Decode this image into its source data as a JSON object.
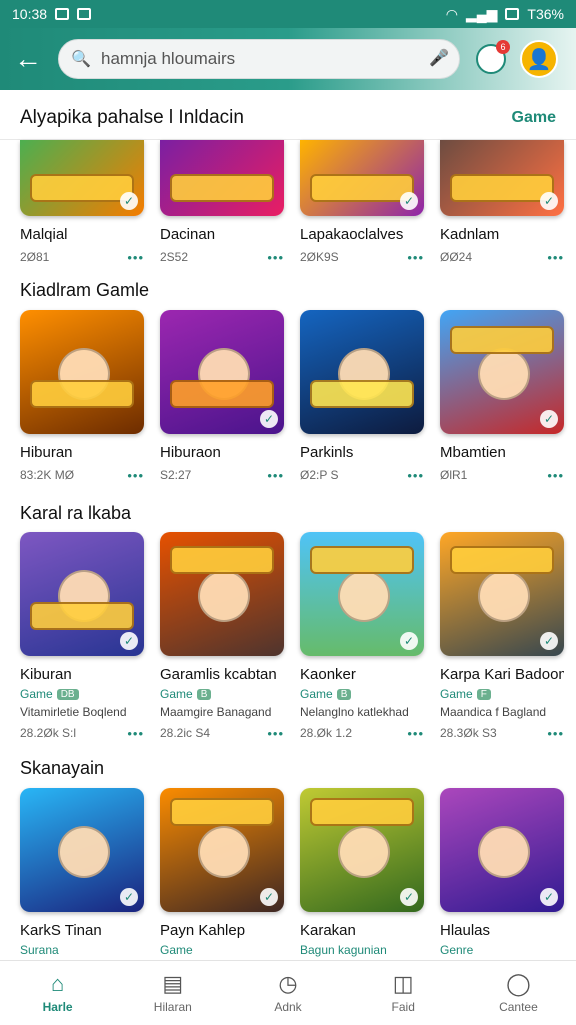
{
  "status": {
    "time": "10:38",
    "battery": "T36%"
  },
  "search": {
    "value": "hamnja hloumairs"
  },
  "notifications": {
    "badge": "6"
  },
  "header": {
    "title": "Alyapika pahalse l Inldacin",
    "tab_label": "Game"
  },
  "sections": [
    {
      "items": [
        {
          "name": "Malqial",
          "count": "2Ø81"
        },
        {
          "name": "Dacinan",
          "count": "2S52"
        },
        {
          "name": "Lapakaoclalves",
          "count": "2ØK9S"
        },
        {
          "name": "Kadnlam",
          "count": "ØØ24"
        }
      ]
    },
    {
      "title": "Kiadlram Gamle",
      "items": [
        {
          "name": "Hiburan",
          "count": "83:2K MØ"
        },
        {
          "name": "Hiburaon",
          "count": "S2:27"
        },
        {
          "name": "Parkinls",
          "count": "Ø2:P S"
        },
        {
          "name": "Mbamtien",
          "count": "ØlR1"
        }
      ]
    },
    {
      "title": "Karal ra lkaba",
      "items": [
        {
          "name": "Kiburan",
          "tag": "Game",
          "badge": "DB",
          "desc": "Vitamirletie Boqlend",
          "count": "28.2Øk S:l"
        },
        {
          "name": "Garamlis kcabtan",
          "tag": "Game",
          "badge": "B",
          "desc": "Maamgire Banagand",
          "count": "28.2ic S4"
        },
        {
          "name": "Kaonker",
          "tag": "Game",
          "badge": "B",
          "desc": "Nelanglno katlekhad",
          "count": "28.Øk 1.2"
        },
        {
          "name": "Karpa Kari Badoom",
          "tag": "Game",
          "badge": "F",
          "desc": "Maandica f Bagland",
          "count": "28.3Øk S3"
        }
      ]
    },
    {
      "title": "Skanayain",
      "items": [
        {
          "name": "KarkS Tinan",
          "tag": "Surana"
        },
        {
          "name": "Payn Kahlep",
          "tag": "Game"
        },
        {
          "name": "Karakan",
          "tag": "Bagun kagunian"
        },
        {
          "name": "Hlaulas",
          "tag": "Genre"
        }
      ]
    }
  ],
  "bottom_nav": [
    {
      "label": "Harle",
      "icon": "home-icon"
    },
    {
      "label": "Hilaran",
      "icon": "news-icon"
    },
    {
      "label": "Adnk",
      "icon": "clock-icon"
    },
    {
      "label": "Faid",
      "icon": "bag-icon"
    },
    {
      "label": "Cantee",
      "icon": "person-icon"
    }
  ],
  "colors": {
    "accent": "#1f8a78"
  }
}
